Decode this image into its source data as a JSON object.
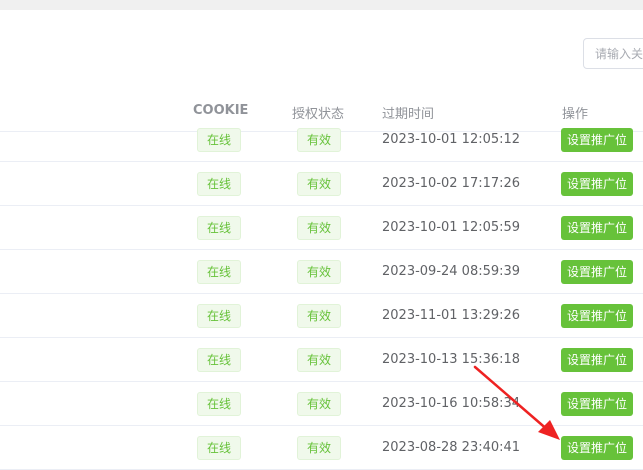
{
  "search": {
    "placeholder": "请输入关"
  },
  "table": {
    "columns": [
      "COOKIE",
      "授权状态",
      "过期时间",
      "操作"
    ],
    "rows": [
      {
        "status": "在线",
        "auth": "有效",
        "expiry": "2023-10-01 12:05:12",
        "action": "设置推广位"
      },
      {
        "status": "在线",
        "auth": "有效",
        "expiry": "2023-10-02 17:17:26",
        "action": "设置推广位"
      },
      {
        "status": "在线",
        "auth": "有效",
        "expiry": "2023-10-01 12:05:59",
        "action": "设置推广位"
      },
      {
        "status": "在线",
        "auth": "有效",
        "expiry": "2023-09-24 08:59:39",
        "action": "设置推广位"
      },
      {
        "status": "在线",
        "auth": "有效",
        "expiry": "2023-11-01 13:29:26",
        "action": "设置推广位"
      },
      {
        "status": "在线",
        "auth": "有效",
        "expiry": "2023-10-13 15:36:18",
        "action": "设置推广位"
      },
      {
        "status": "在线",
        "auth": "有效",
        "expiry": "2023-10-16 10:58:34",
        "action": "设置推广位"
      },
      {
        "status": "在线",
        "auth": "有效",
        "expiry": "2023-08-28 23:40:41",
        "action": "设置推广位"
      }
    ]
  },
  "colors": {
    "success": "#67c23a",
    "success_bg": "#f0f9eb",
    "annotation_arrow": "#ee2222"
  }
}
